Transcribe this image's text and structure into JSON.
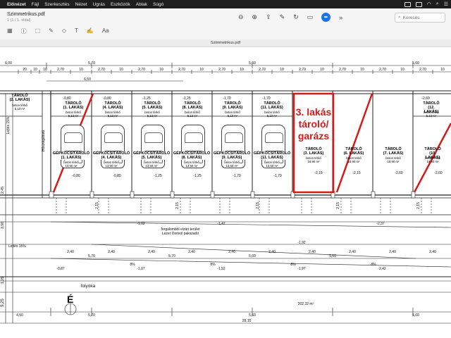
{
  "menubar": {
    "apple": "",
    "items": [
      "Fájl",
      "Szerkesztés",
      "Nézet",
      "Ugrás",
      "Eszközök",
      "Ablak",
      "Súgó"
    ],
    "app": "Előnézet"
  },
  "titlebar": {
    "file_name": "Szimmetrikus.pdf",
    "page_info": "1 (1 / 1. oldal)",
    "search_placeholder": "Keresés"
  },
  "document_tab": "Szimmetrikus.pdf",
  "accent_color": "#d61a1a",
  "plan": {
    "top_dims": [
      "6,00",
      "5,70",
      "5,60",
      "5,60"
    ],
    "second_dims": [
      "20",
      "10",
      "2,70",
      "10",
      "2,70",
      "10",
      "2,70",
      "10",
      "2,70",
      "10",
      "2,70",
      "10",
      "2,70",
      "10",
      "2,70",
      "10",
      "2,70",
      "10",
      "2,70",
      "10",
      "2,70",
      "10"
    ],
    "dim_650": "6,50",
    "units": [
      {
        "title": "TÁROLÓ\n(2. LAKÁS)",
        "sub": "beton térkő\n5,13 m²",
        "elev": "-0,80"
      },
      {
        "title": "TÁROLÓ\n(1. LAKÁS)",
        "sub": "beton térkő\n5,13 m²",
        "elev": "-0,80"
      },
      {
        "title": "TÁROLÓ\n(4. LAKÁS)",
        "sub": "beton térkő\n5,13 m²",
        "elev": "-0,80"
      },
      {
        "title": "TÁROLÓ\n(5. LAKÁS)",
        "sub": "beton térkő\n5,13 m²",
        "elev": "-1,25"
      },
      {
        "title": "TÁROLÓ\n(8. LAKÁS)",
        "sub": "beton térkő\n5,13 m²",
        "elev": "-1,25"
      },
      {
        "title": "TÁROLÓ\n(9. LAKÁS)",
        "sub": "beton térkő\n5,13 m²",
        "elev": "-1,70"
      },
      {
        "title": "TÁROLÓ\n(11. LAKÁS)",
        "sub": "beton térkő\n5,13 m²",
        "elev": "-1,70"
      },
      {
        "title": "TÁROLÓ\n(12. LAKÁS)",
        "sub": "beton térkő\n5,13 m²",
        "elev": "-2,60"
      }
    ],
    "garages": [
      {
        "title": "GÉPKOCSITÁROLÓ\n(1. LAKÁS)",
        "sub": "beton térkő\n13,50 m²",
        "elev": "-0,80"
      },
      {
        "title": "GÉPKOCSITÁROLÓ\n(4. LAKÁS)",
        "sub": "beton térkő\n13,50 m²",
        "elev": "-0,80"
      },
      {
        "title": "GÉPKOCSITÁROLÓ\n(5. LAKÁS)",
        "sub": "beton térkő\n13,50 m²",
        "elev": "-1,25"
      },
      {
        "title": "GÉPKOCSITÁROLÓ\n(8. LAKÁS)",
        "sub": "beton térkő\n13,50 m²",
        "elev": "-1,25"
      },
      {
        "title": "GÉPKOCSITÁROLÓ\n(9. LAKÁS)",
        "sub": "beton térkő\n13,50 m²",
        "elev": "-1,70"
      },
      {
        "title": "GÉPKOCSITÁROLÓ\n(11. LAKÁS)",
        "sub": "beton térkő\n13,50 m²",
        "elev": "-1,70"
      }
    ],
    "big_units": [
      {
        "title": "TÁROLÓ\n(3. LAKÁS)",
        "sub": "beton térkő\n18,90 m²",
        "elev": "-2,15"
      },
      {
        "title": "TÁROLÓ\n(6. LAKÁS)",
        "sub": "beton térkő\n18,90 m²",
        "elev": "-2,15"
      },
      {
        "title": "TÁROLÓ\n(7. LAKÁS)",
        "sub": "beton térkő\n18,90 m²",
        "elev": "-2,60"
      },
      {
        "title": "TÁROLÓ\n(10. LAKÁS)",
        "sub": "beton térkő\n18,90 m²",
        "elev": "-2,60"
      }
    ],
    "highlight_text": "3. lakás\ntároló/\ngarázs",
    "hoaszolg": "Hőszolgáltató",
    "lejtes_left": "Lejtés 15%",
    "lejtes_bottom": "Lejtés 15%",
    "traffic_note": "forgalomból elzárt terület\nLezer Dorisol pakszadó",
    "folyoka": "folyóka",
    "area": "202,32 m²",
    "north": "É",
    "bottom_dims": [
      "4,50",
      "5,70",
      "5,60",
      "5,60"
    ],
    "bottom_total": "28,10",
    "row_dims": [
      "2,40",
      "20",
      "2,60",
      "20",
      "2,40",
      "20",
      "2,40",
      "20",
      "2,40",
      "20",
      "2,40",
      "20",
      "2,40",
      "20",
      "2,40",
      "20",
      "2,40",
      "20",
      "2,40",
      "20",
      "2,40"
    ],
    "row_totals": [
      "5,70",
      "5,70",
      "5,60",
      "5,60"
    ],
    "left_dims": [
      "2,45",
      "3,90",
      "1,25",
      "5,25"
    ],
    "bottom_elev": [
      "-0,87",
      "-1,07",
      "-1,52",
      "-1,97",
      "-2,42"
    ],
    "mid_elev": [
      "-1,02",
      "-1,47",
      "-1,92",
      "-2,37"
    ],
    "pct": [
      "8%",
      "8%",
      "8%",
      "8%"
    ],
    "side_labels": [
      "2,15",
      "2,15",
      "2,15",
      "2,15",
      "2,15"
    ]
  }
}
